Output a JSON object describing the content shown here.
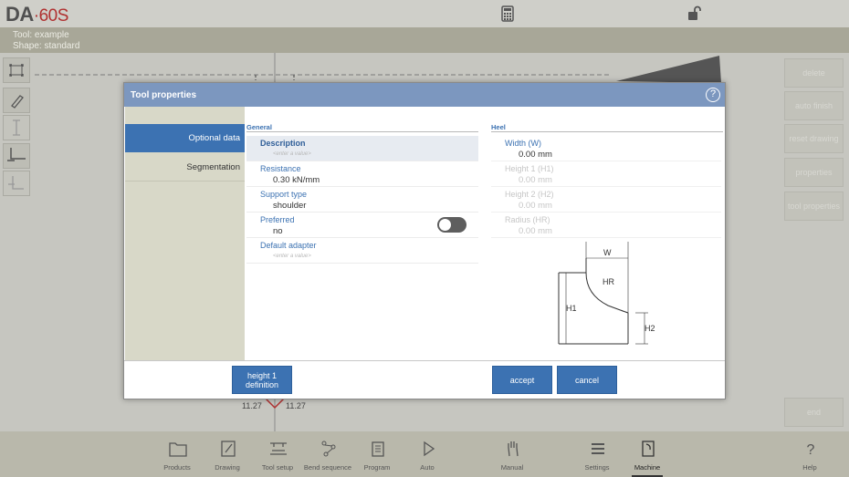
{
  "app": {
    "brand": "DA",
    "model": "60S"
  },
  "info": {
    "tool": "Tool: example",
    "shape": "Shape: standard"
  },
  "canvas": {
    "dim_left": "11.27",
    "dim_right": "11.27"
  },
  "right_buttons": [
    {
      "label": "delete"
    },
    {
      "label": "auto finish"
    },
    {
      "label": "reset drawing"
    },
    {
      "label": "properties"
    },
    {
      "label": "tool properties"
    },
    {
      "label": "end"
    }
  ],
  "nav": [
    {
      "label": "Products",
      "icon": "folder-icon"
    },
    {
      "label": "Drawing",
      "icon": "drawing-icon"
    },
    {
      "label": "Tool setup",
      "icon": "tool-setup-icon"
    },
    {
      "label": "Bend sequence",
      "icon": "bend-sequence-icon"
    },
    {
      "label": "Program",
      "icon": "program-icon"
    },
    {
      "label": "Auto",
      "icon": "play-icon"
    },
    {
      "label": "Manual",
      "icon": "hand-icon"
    },
    {
      "label": "Settings",
      "icon": "settings-icon"
    },
    {
      "label": "Machine",
      "icon": "machine-icon"
    },
    {
      "label": "Help",
      "icon": "help-icon"
    }
  ],
  "dialog": {
    "title": "Tool properties",
    "help": "?",
    "tabs": [
      "Optional data",
      "Segmentation"
    ],
    "general_title": "General",
    "heel_title": "Heel",
    "fields": [
      {
        "label": "Description",
        "value": "",
        "placeholder": "<enter a value>"
      },
      {
        "label": "Resistance",
        "value": "0.30 kN/mm"
      },
      {
        "label": "Support type",
        "value": "shoulder"
      },
      {
        "label": "Preferred",
        "value": "no"
      },
      {
        "label": "Default adapter",
        "value": "",
        "placeholder": "<enter a value>"
      }
    ],
    "heel_fields": [
      {
        "label": "Width (W)",
        "value": "0.00 mm"
      },
      {
        "label": "Height 1 (H1)",
        "value": "0.00 mm"
      },
      {
        "label": "Height 2 (H2)",
        "value": "0.00 mm"
      },
      {
        "label": "Radius (HR)",
        "value": "0.00 mm"
      }
    ],
    "diagram": {
      "w": "W",
      "hr": "HR",
      "h1": "H1",
      "h2": "H2"
    },
    "buttons": {
      "height_def": "height 1 definition",
      "accept": "accept",
      "cancel": "cancel"
    }
  }
}
